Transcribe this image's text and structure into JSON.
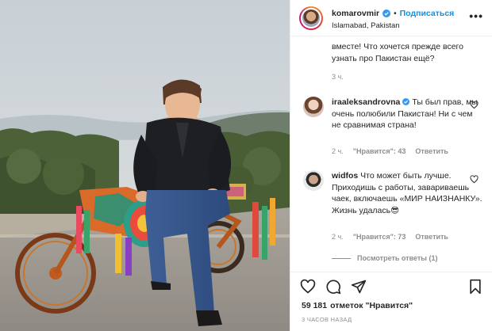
{
  "header": {
    "username": "komarovmir",
    "separator": "•",
    "follow_label": "Подписаться",
    "location": "Islamabad, Pakistan",
    "more_label": "•••"
  },
  "comments": [
    {
      "username": "",
      "text": "вместе! Что хочется прежде всего узнать про Пакистан ещё?",
      "time": "3 ч."
    },
    {
      "username": "iraaleksandrovna",
      "text": "Ты был прав, мы очень полюбили Пакистан! Ни с чем не сравнимая страна!",
      "time": "2 ч.",
      "likes": "\"Нравится\": 43",
      "reply": "Ответить"
    },
    {
      "username": "widfos",
      "text": "Что может быть лучше. Приходишь с работы, завариваешь чаек, включаешь «МИР НАИЗНАНКУ». Жизнь удалась😎",
      "time": "2 ч.",
      "likes": "\"Нравится\": 73",
      "reply": "Ответить"
    }
  ],
  "view_replies": "Посмотреть ответы (1)",
  "footer": {
    "likes_count": "59 181",
    "likes_text": "отметок \"Нравится\"",
    "time_ago": "3 ЧАСОВ НАЗАД"
  },
  "colors": {
    "accent": "#0095f6",
    "verified": "#3897f0",
    "text": "#262626",
    "muted": "#8e8e8e",
    "border": "#efefef"
  },
  "icons": [
    "verified-badge-icon",
    "more-options-icon",
    "heart-icon",
    "comment-icon",
    "share-icon",
    "bookmark-icon"
  ]
}
